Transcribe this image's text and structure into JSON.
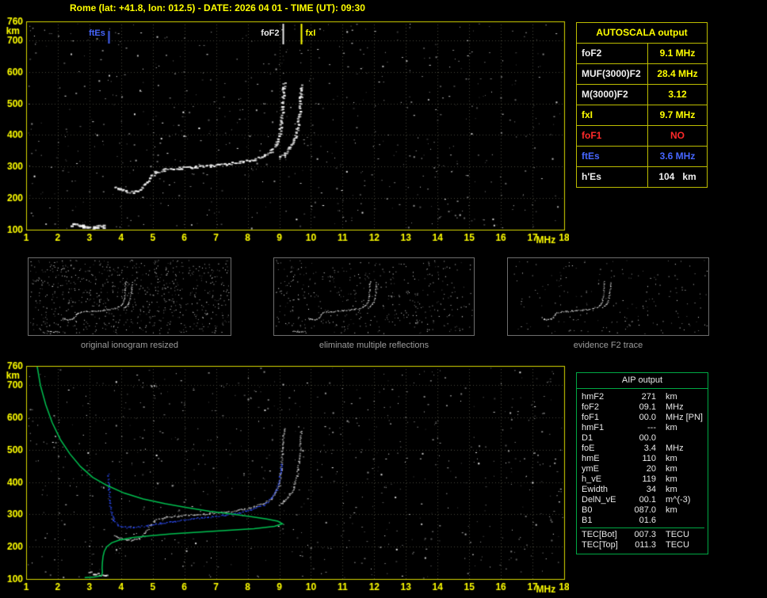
{
  "title": "Rome (lat: +41.8, lon: 012.5) - DATE: 2026 04 01 - TIME (UT): 09:30",
  "theme": {
    "bg": "#000000",
    "yellow": "#ffff00",
    "axis": "#d8d800",
    "grid": "#46463a",
    "white": "#f0f0f0",
    "red": "#ff2a2a",
    "blue": "#4666ff",
    "green": "#00c050",
    "caption_gray": "#9c9c9c"
  },
  "autoscala": {
    "header": "AUTOSCALA output",
    "rows": [
      {
        "label": "foF2",
        "value": "9.1 MHz",
        "label_color": "#f0f0f0",
        "value_color": "#ffff00"
      },
      {
        "label": "MUF(3000)F2",
        "value": "28.4 MHz",
        "label_color": "#f0f0f0",
        "value_color": "#ffff00"
      },
      {
        "label": "M(3000)F2",
        "value": "3.12",
        "label_color": "#f0f0f0",
        "value_color": "#ffff00"
      },
      {
        "label": "fxI",
        "value": "9.7 MHz",
        "label_color": "#ffff00",
        "value_color": "#ffff00"
      },
      {
        "label": "foF1",
        "value": "NO",
        "label_color": "#ff2a2a",
        "value_color": "#ff2a2a"
      },
      {
        "label": "ftEs",
        "value": "3.6 MHz",
        "label_color": "#4666ff",
        "value_color": "#4666ff"
      },
      {
        "label": "h'Es",
        "value": "104   km",
        "label_color": "#f0f0f0",
        "value_color": "#f0f0f0"
      }
    ]
  },
  "thumbnails": [
    {
      "caption": "original ionogram resized",
      "noise_count": 760,
      "trace_alpha": 1,
      "traces": [
        "es",
        "f2o",
        "f2x"
      ],
      "seed": 11
    },
    {
      "caption": "eliminate multiple reflections",
      "noise_count": 430,
      "trace_alpha": 1,
      "traces": [
        "es",
        "f2o",
        "f2x"
      ],
      "seed": 22
    },
    {
      "caption": "evidence F2 trace",
      "noise_count": 190,
      "trace_alpha": 0.85,
      "traces": [
        "f2o",
        "f2x"
      ],
      "seed": 33
    }
  ],
  "aip": {
    "header": "AIP output",
    "rows": [
      {
        "name": "hmF2",
        "value": "271",
        "unit": "km",
        "note": ""
      },
      {
        "name": "foF2",
        "value": "09.1",
        "unit": "MHz",
        "note": ""
      },
      {
        "name": "foF1",
        "value": "00.0",
        "unit": "MHz",
        "note": "[PN]"
      },
      {
        "name": "hmF1",
        "value": "---",
        "unit": "km",
        "note": ""
      },
      {
        "name": "D1",
        "value": "00.0",
        "unit": "",
        "note": ""
      },
      {
        "name": "foE",
        "value": "3.4",
        "unit": "MHz",
        "note": ""
      },
      {
        "name": "hmE",
        "value": "110",
        "unit": "km",
        "note": ""
      },
      {
        "name": "ymE",
        "value": "20",
        "unit": "km",
        "note": ""
      },
      {
        "name": "h_vE",
        "value": "119",
        "unit": "km",
        "note": ""
      },
      {
        "name": "Ewidth",
        "value": "34",
        "unit": "km",
        "note": ""
      },
      {
        "name": "DelN_vE",
        "value": "00.1",
        "unit": "m^(-3)",
        "note": ""
      },
      {
        "name": "B0",
        "value": "087.0",
        "unit": "km",
        "note": ""
      },
      {
        "name": "B1",
        "value": "01.6",
        "unit": "",
        "note": ""
      },
      {
        "name": "TEC[Bot]",
        "value": "007.3",
        "unit": "TECU",
        "note": ""
      },
      {
        "name": "TEC[Top]",
        "value": "011.3",
        "unit": "TECU",
        "note": ""
      }
    ]
  },
  "chart_data": [
    {
      "id": "top",
      "type": "scatter",
      "title": "",
      "xlabel": "MHz",
      "ylabel": "km",
      "xlim": [
        1,
        18
      ],
      "ylim": [
        100,
        760
      ],
      "xticks": [
        1,
        2,
        3,
        4,
        5,
        6,
        7,
        8,
        9,
        10,
        11,
        12,
        13,
        14,
        15,
        16,
        17,
        18
      ],
      "yticks": [
        100,
        200,
        300,
        400,
        500,
        600,
        700,
        760
      ],
      "grid": true,
      "noise": {
        "count": 640,
        "seed": 7
      },
      "markers": [
        {
          "label": "ftEs",
          "freq": 3.6,
          "color": "#4666ff",
          "side": "left",
          "top": 12,
          "len": 16
        },
        {
          "label": "foF2",
          "freq": 9.1,
          "color": "#e8e8e8",
          "side": "left",
          "top": 3,
          "len": 26
        },
        {
          "label": "fxI",
          "freq": 9.7,
          "color": "#ffff00",
          "side": "right",
          "top": 3,
          "len": 26
        }
      ],
      "traces": [
        {
          "name": "es",
          "style": "dots",
          "color": "#ffffff",
          "width": 4,
          "points": [
            [
              2.45,
              118
            ],
            [
              2.8,
              113
            ],
            [
              3.15,
              110
            ],
            [
              3.45,
              112
            ]
          ]
        },
        {
          "name": "f2o",
          "style": "dots",
          "color": "#ffffff",
          "width": 3,
          "points": [
            [
              3.78,
              238
            ],
            [
              3.95,
              228
            ],
            [
              4.15,
              222
            ],
            [
              4.35,
              221
            ],
            [
              4.55,
              226
            ],
            [
              4.75,
              244
            ],
            [
              4.9,
              266
            ],
            [
              5.05,
              283
            ],
            [
              5.35,
              291
            ],
            [
              5.8,
              296
            ],
            [
              6.3,
              300
            ],
            [
              6.8,
              304
            ],
            [
              7.3,
              309
            ],
            [
              7.8,
              316
            ],
            [
              8.2,
              325
            ],
            [
              8.5,
              336
            ],
            [
              8.72,
              350
            ],
            [
              8.88,
              370
            ],
            [
              8.98,
              398
            ],
            [
              9.04,
              440
            ],
            [
              9.08,
              490
            ],
            [
              9.11,
              545
            ],
            [
              9.13,
              568
            ]
          ]
        },
        {
          "name": "f2x",
          "style": "dots",
          "color": "#ffffff",
          "width": 3,
          "points": [
            [
              8.98,
              330
            ],
            [
              9.15,
              342
            ],
            [
              9.3,
              360
            ],
            [
              9.44,
              384
            ],
            [
              9.54,
              418
            ],
            [
              9.61,
              468
            ],
            [
              9.65,
              522
            ],
            [
              9.67,
              560
            ]
          ]
        }
      ]
    },
    {
      "id": "bottom",
      "type": "scatter",
      "title": "",
      "xlabel": "MHz",
      "ylabel": "km",
      "xlim": [
        1,
        18
      ],
      "ylim": [
        100,
        760
      ],
      "xticks": [
        1,
        2,
        3,
        4,
        5,
        6,
        7,
        8,
        9,
        10,
        11,
        12,
        13,
        14,
        15,
        16,
        17,
        18
      ],
      "yticks": [
        100,
        200,
        300,
        400,
        500,
        600,
        700,
        760
      ],
      "grid": true,
      "noise": {
        "count": 700,
        "seed": 19
      },
      "markers": [],
      "traces": [
        {
          "name": "es",
          "style": "dots",
          "color": "#ffffff",
          "width": 3,
          "points": [
            [
              3.0,
              122
            ],
            [
              3.3,
              115
            ],
            [
              3.5,
              112
            ]
          ]
        },
        {
          "name": "f2o",
          "style": "dots",
          "color": "#d8d8d8",
          "width": 2,
          "points": [
            [
              3.78,
              238
            ],
            [
              3.95,
              228
            ],
            [
              4.15,
              222
            ],
            [
              4.35,
              221
            ],
            [
              4.55,
              226
            ],
            [
              4.75,
              244
            ],
            [
              4.9,
              266
            ],
            [
              5.05,
              283
            ],
            [
              5.35,
              291
            ],
            [
              5.8,
              296
            ],
            [
              6.3,
              300
            ],
            [
              6.8,
              304
            ],
            [
              7.3,
              309
            ],
            [
              7.8,
              316
            ],
            [
              8.2,
              325
            ],
            [
              8.5,
              336
            ],
            [
              8.72,
              350
            ],
            [
              8.88,
              370
            ],
            [
              8.98,
              398
            ],
            [
              9.04,
              440
            ],
            [
              9.08,
              490
            ],
            [
              9.11,
              545
            ],
            [
              9.13,
              568
            ]
          ]
        },
        {
          "name": "f2x",
          "style": "dots",
          "color": "#d8d8d8",
          "width": 2,
          "points": [
            [
              8.98,
              330
            ],
            [
              9.15,
              342
            ],
            [
              9.3,
              360
            ],
            [
              9.44,
              384
            ],
            [
              9.54,
              418
            ],
            [
              9.61,
              468
            ],
            [
              9.65,
              522
            ],
            [
              9.67,
              560
            ]
          ]
        },
        {
          "name": "fitted",
          "style": "dots",
          "color": "#2f4fff",
          "width": 2,
          "points": [
            [
              3.58,
              428
            ],
            [
              3.6,
              382
            ],
            [
              3.63,
              338
            ],
            [
              3.68,
              306
            ],
            [
              3.76,
              284
            ],
            [
              3.9,
              268
            ],
            [
              4.1,
              261
            ],
            [
              4.4,
              260
            ],
            [
              4.8,
              266
            ],
            [
              5.2,
              273
            ],
            [
              5.7,
              280
            ],
            [
              6.2,
              287
            ],
            [
              6.7,
              292
            ],
            [
              7.2,
              298
            ],
            [
              7.7,
              306
            ],
            [
              8.1,
              315
            ],
            [
              8.5,
              331
            ],
            [
              8.75,
              352
            ],
            [
              8.9,
              378
            ],
            [
              9.0,
              415
            ],
            [
              9.06,
              458
            ]
          ]
        },
        {
          "name": "profile",
          "style": "line",
          "color": "#00c050",
          "width": 1.5,
          "points": [
            [
              1.35,
              758
            ],
            [
              1.45,
              700
            ],
            [
              1.62,
              640
            ],
            [
              1.82,
              585
            ],
            [
              2.08,
              532
            ],
            [
              2.38,
              488
            ],
            [
              2.72,
              448
            ],
            [
              3.1,
              415
            ],
            [
              3.55,
              390
            ],
            [
              4.1,
              366
            ],
            [
              4.7,
              348
            ],
            [
              5.4,
              333
            ],
            [
              6.1,
              321
            ],
            [
              6.8,
              310
            ],
            [
              7.5,
              301
            ],
            [
              8.1,
              293
            ],
            [
              8.6,
              286
            ],
            [
              8.95,
              279
            ],
            [
              9.1,
              271
            ],
            [
              8.85,
              263
            ],
            [
              8.2,
              256
            ],
            [
              7.3,
              250
            ],
            [
              6.4,
              245
            ],
            [
              5.6,
              240
            ],
            [
              4.9,
              234
            ],
            [
              4.35,
              228
            ],
            [
              3.95,
              221
            ],
            [
              3.7,
              212
            ],
            [
              3.55,
              200
            ],
            [
              3.47,
              186
            ],
            [
              3.43,
              170
            ],
            [
              3.41,
              152
            ],
            [
              3.4,
              134
            ],
            [
              3.41,
              120
            ],
            [
              3.38,
              110
            ],
            [
              3.15,
              106
            ],
            [
              2.85,
              104
            ]
          ]
        }
      ]
    }
  ]
}
